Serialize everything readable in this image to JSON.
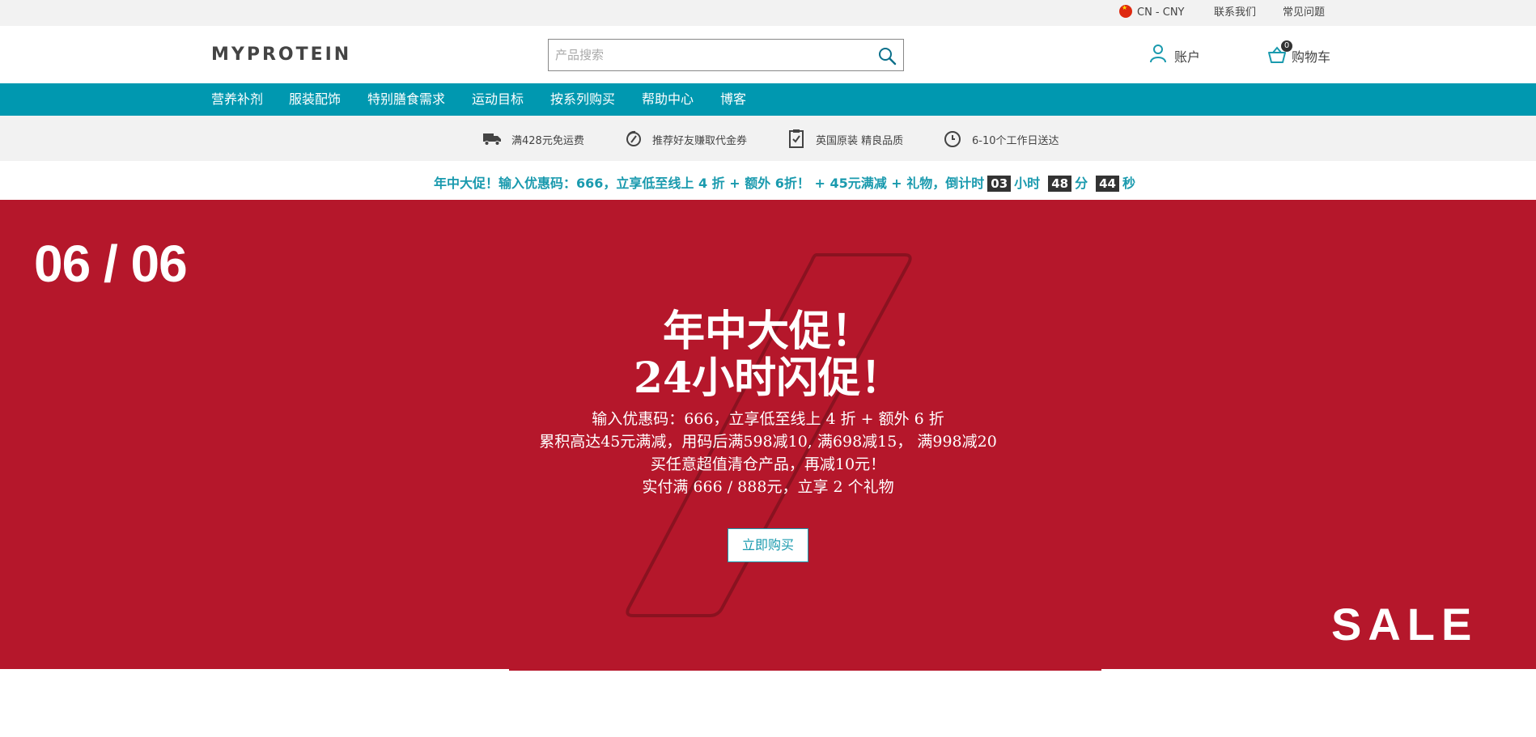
{
  "utility": {
    "locale": "CN - CNY",
    "contact": "联系我们",
    "faq": "常见问题"
  },
  "header": {
    "logo": "MYPROTEIN",
    "search_placeholder": "产品搜索",
    "account_label": "账户",
    "cart_label": "购物车",
    "cart_count": "0"
  },
  "nav": {
    "items": [
      {
        "label": "营养补剂"
      },
      {
        "label": "服装配饰"
      },
      {
        "label": "特别膳食需求"
      },
      {
        "label": "运动目标"
      },
      {
        "label": "按系列购买"
      },
      {
        "label": "帮助中心"
      },
      {
        "label": "博客"
      }
    ]
  },
  "benefits": [
    {
      "label": "满428元免运费",
      "icon": "truck-icon"
    },
    {
      "label": "推荐好友赚取代金券",
      "icon": "voucher-icon"
    },
    {
      "label": "英国原装 精良品质",
      "icon": "clipboard-check-icon"
    },
    {
      "label": "6-10个工作日送达",
      "icon": "clock-icon"
    }
  ],
  "promo": {
    "text": "年中大促！输入优惠码：666，立享低至线上 4 折 + 额外 6折！ + 45元满减 + 礼物，倒计时",
    "hours": "03",
    "hours_unit": "小时",
    "minutes": "48",
    "minutes_unit": "分",
    "seconds": "44",
    "seconds_unit": "秒"
  },
  "hero": {
    "date": "06 / 06",
    "title_line1": "年中大促！",
    "title_line2": "24小时闪促！",
    "sub_lines": [
      "输入优惠码：666，立享低至线上 4 折 + 额外 6 折",
      "累积高达45元满减，用码后满598减10, 满698减15， 满998减20",
      "买任意超值清仓产品，再减10元！",
      "实付满 666 / 888元，立享 2 个礼物"
    ],
    "cta_label": "立即购买",
    "sale_text": "SALE",
    "colors": {
      "background": "#b5172b",
      "accent": "#1a9aae"
    }
  }
}
